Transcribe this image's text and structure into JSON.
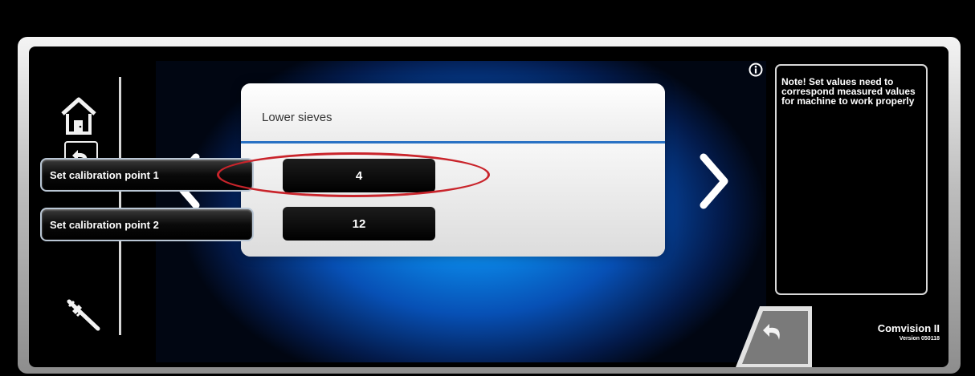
{
  "panel": {
    "title": "Lower sieves",
    "rows": [
      {
        "button_label": "Set calibration point 1",
        "value": "4"
      },
      {
        "button_label": "Set calibration point 2",
        "value": "12"
      }
    ]
  },
  "note": {
    "text": "Note! Set values need to correspond measured values for machine to work properly"
  },
  "brand": {
    "name": "Comvision II",
    "version": "Version 050118"
  },
  "icons": {
    "home": "home-icon",
    "back": "back-icon",
    "calibration_tool": "caliper-icon",
    "prev": "chevron-left-icon",
    "next": "chevron-right-icon",
    "info": "info-icon",
    "return": "return-icon"
  },
  "colors": {
    "highlight": "#c9242b",
    "screen_blue": "#0a7fe0",
    "panel_accent": "#2a72c4"
  }
}
